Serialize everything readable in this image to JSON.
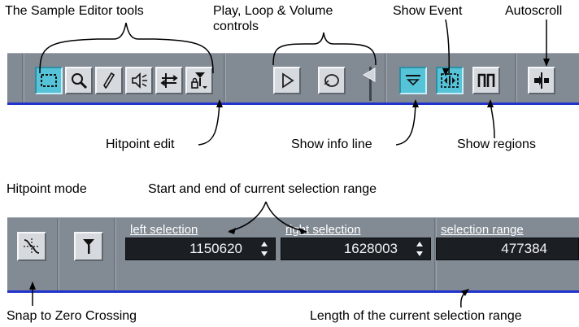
{
  "top_callouts": {
    "sample_editor_tools": "The Sample Editor tools",
    "play_loop_volume": "Play, Loop & Volume controls",
    "show_event": "Show Event",
    "autoscroll": "Autoscroll",
    "hitpoint_edit": "Hitpoint edit",
    "show_info_line": "Show info line",
    "show_regions": "Show regions"
  },
  "bottom_callouts": {
    "hitpoint_mode": "Hitpoint mode",
    "selection_range_start_end": "Start and end of current selection range",
    "snap_zero_crossing": "Snap to Zero Crossing",
    "length_selection_range": "Length of the current selection range"
  },
  "toolbar_top": {
    "buttons": [
      {
        "name": "range-selection",
        "icon": "dashed-rectangle-icon",
        "active": true
      },
      {
        "name": "zoom",
        "icon": "magnifier-icon",
        "active": false
      },
      {
        "name": "draw",
        "icon": "pencil-icon",
        "active": false
      },
      {
        "name": "audition",
        "icon": "speaker-icon",
        "active": false
      },
      {
        "name": "scrub",
        "icon": "scrub-arrows-icon",
        "active": false
      },
      {
        "name": "hitpoint-edit",
        "icon": "hitpoint-lock-icon",
        "active": false
      },
      {
        "name": "play",
        "icon": "play-triangle-icon",
        "active": false
      },
      {
        "name": "loop",
        "icon": "loop-icon",
        "active": false
      },
      {
        "name": "volume",
        "icon": "volume-slider-icon",
        "active": false
      },
      {
        "name": "show-info-line",
        "icon": "info-line-icon",
        "active": true
      },
      {
        "name": "show-event",
        "icon": "show-event-icon",
        "active": true
      },
      {
        "name": "show-regions",
        "icon": "regions-bracket-icon",
        "active": false
      },
      {
        "name": "autoscroll",
        "icon": "autoscroll-icon",
        "active": false
      }
    ]
  },
  "toolbar_bottom": {
    "snap_button_icon": "zero-crossing-icon",
    "hitpoint_mode_icon": "hitpoint-marker-icon",
    "fields": [
      {
        "label": "left selection",
        "value": "1150620"
      },
      {
        "label": "right selection",
        "value": "1628003"
      },
      {
        "label": "selection range",
        "value": "477384"
      }
    ]
  },
  "colors": {
    "toolbar_bg": "#828a94",
    "active_button": "#55c3d8",
    "accent_line": "#2233cc",
    "field_bg": "#1b1f24"
  }
}
